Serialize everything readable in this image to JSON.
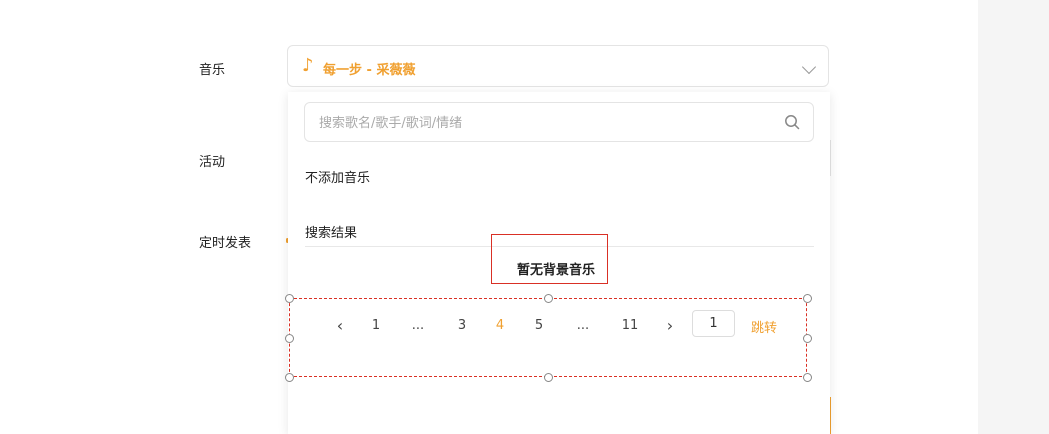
{
  "form": {
    "music_label": "音乐",
    "activity_label": "活动",
    "schedule_label": "定时发表"
  },
  "music_select": {
    "icon": "music-note-icon",
    "value": "每一步 - 采薇薇"
  },
  "dropdown": {
    "search_placeholder": "搜索歌名/歌手/歌词/情绪",
    "no_music": "不添加音乐",
    "results_title": "搜索结果",
    "empty_text": "暂无背景音乐"
  },
  "pagination": {
    "prev": "‹",
    "pages": [
      "1",
      "...",
      "3",
      "4",
      "5",
      "...",
      "11"
    ],
    "current": "4",
    "next": "›",
    "input_value": "1",
    "jump_label": "跳转"
  },
  "colors": {
    "accent": "#f0a030",
    "highlight_border": "#d93025",
    "sidebar_bg": "#f5f5f5"
  }
}
